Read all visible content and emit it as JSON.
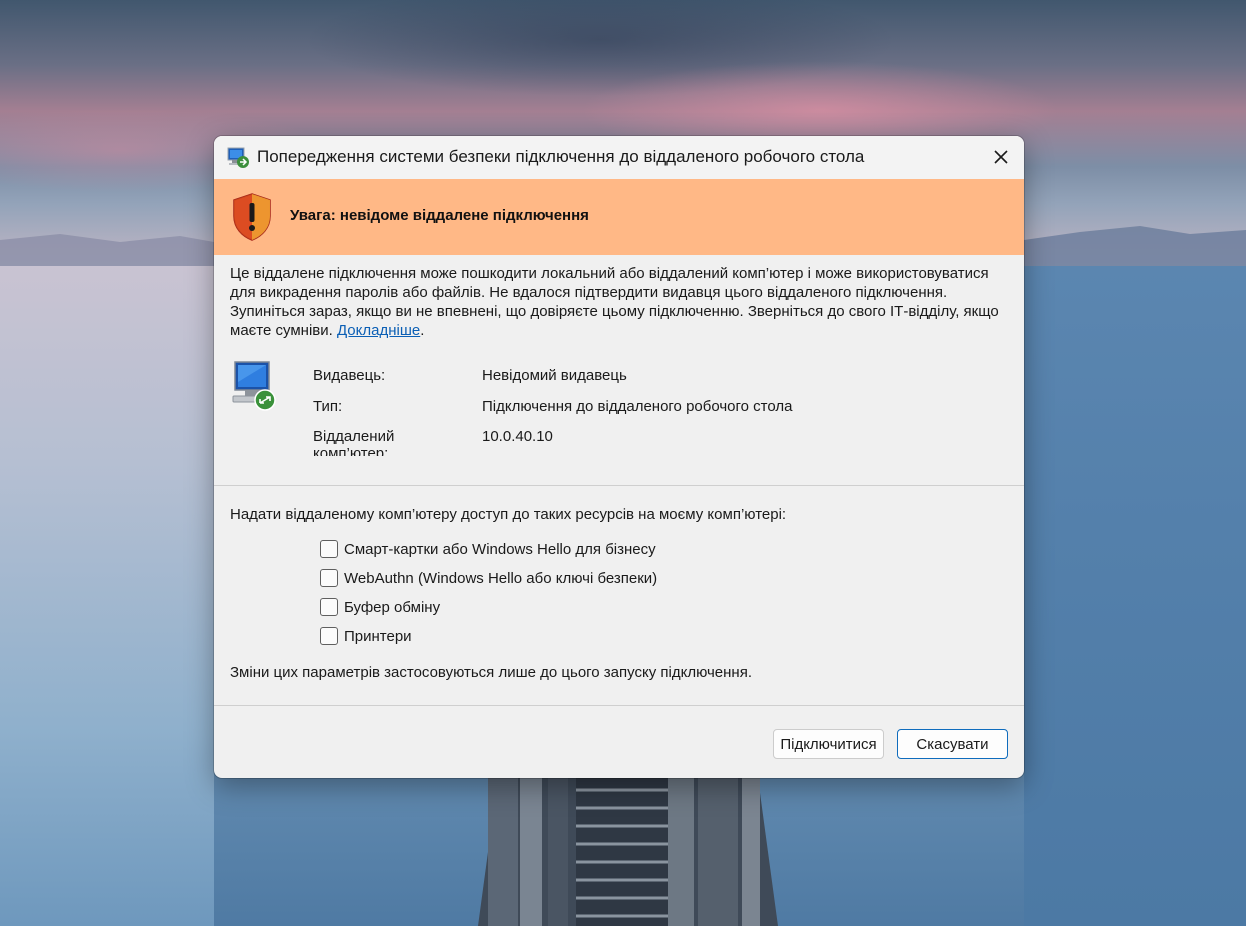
{
  "dialog": {
    "title": "Попередження системи безпеки підключення до віддаленого робочого стола",
    "warning": "Увага: невідоме віддалене підключення",
    "description": "Це віддалене підключення може пошкодити локальний або віддалений комп’ютер і може використовуватися для викрадення паролів або файлів. Не вдалося підтвердити видавця цього віддаленого підключення. Зупиніться зараз, якщо ви не впевнені, що довіряєте цьому підключенню. Зверніться до свого ІТ-відділу, якщо маєте сумніви.",
    "learn_more": "Докладніше",
    "info": {
      "publisher_label": "Видавець:",
      "publisher_value": "Невідомий видавець",
      "type_label": "Тип:",
      "type_value": "Підключення до віддаленого робочого стола",
      "remote_label": "Віддалений комп’ютер:",
      "remote_value": "10.0.40.10"
    },
    "resources_prompt": "Надати віддаленому комп’ютеру доступ до таких ресурсів на моєму комп’ютері:",
    "resources": [
      {
        "label": "Смарт-картки або Windows Hello для бізнесу",
        "checked": false
      },
      {
        "label": "WebAuthn (Windows Hello або ключі безпеки)",
        "checked": false
      },
      {
        "label": "Буфер обміну",
        "checked": false
      },
      {
        "label": "Принтери",
        "checked": false
      }
    ],
    "note": "Зміни цих параметрів застосовуються лише до цього запуску підключення.",
    "buttons": {
      "connect": "Підключитися",
      "cancel": "Скасувати"
    }
  },
  "colors": {
    "banner": "#ffb886",
    "link": "#0b5fb5",
    "accent": "#0f6cbd"
  }
}
